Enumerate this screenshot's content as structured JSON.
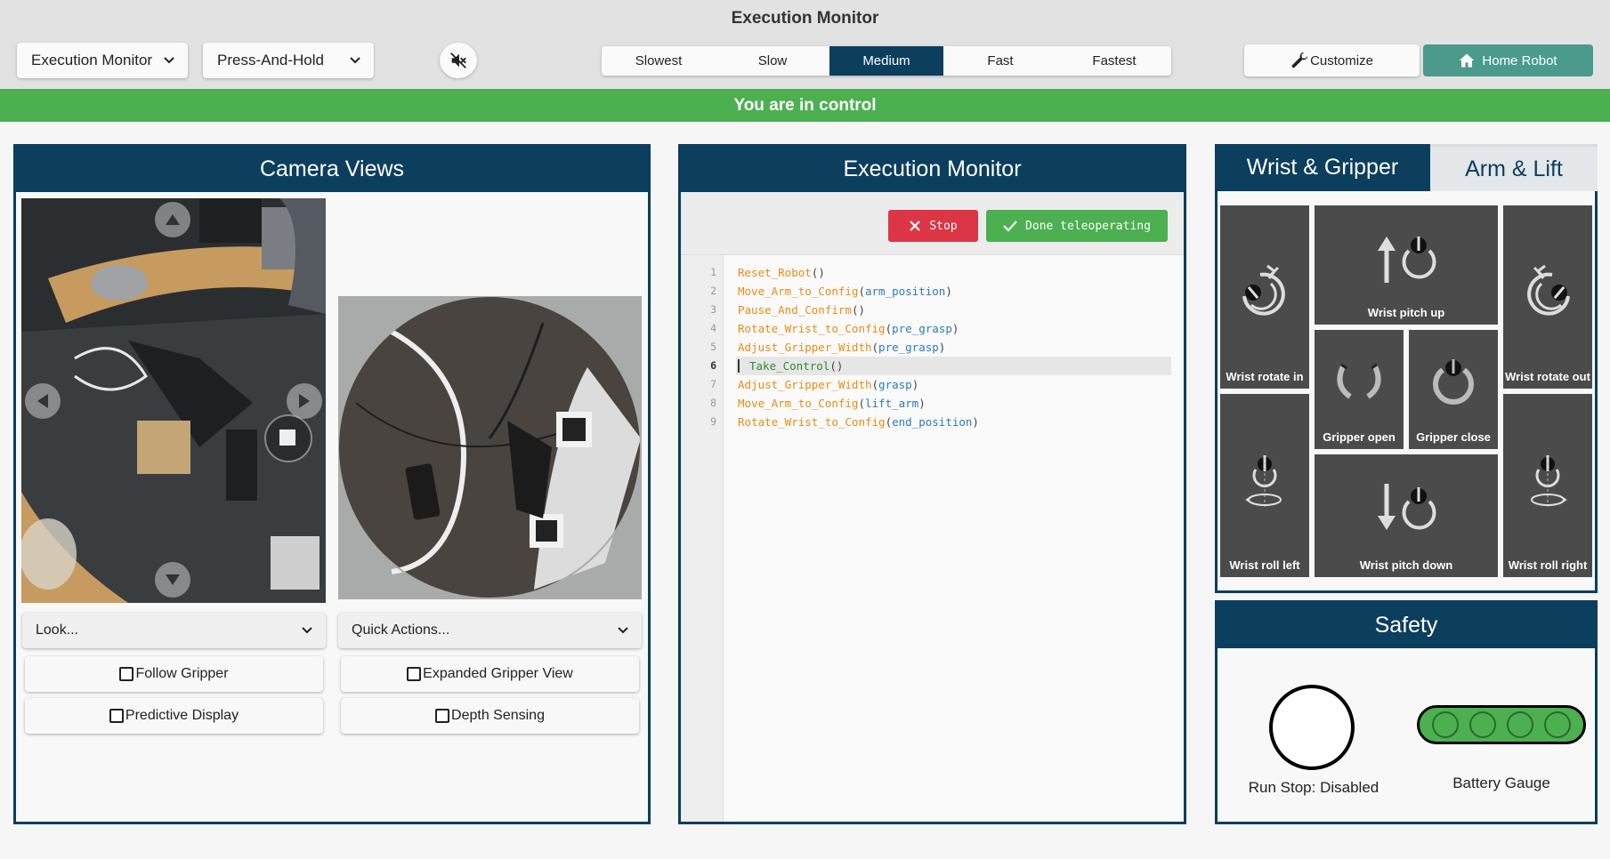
{
  "header": {
    "title": "Execution Monitor",
    "mode_select": "Execution Monitor",
    "action_select": "Press-And-Hold",
    "mute_icon": "speaker-muted-icon",
    "speeds": [
      "Slowest",
      "Slow",
      "Medium",
      "Fast",
      "Fastest"
    ],
    "active_speed": "Medium",
    "customize_label": "Customize",
    "home_label": "Home Robot"
  },
  "banner": {
    "text": "You are in control",
    "color": "#4caf50"
  },
  "camera": {
    "title": "Camera Views",
    "look_select": "Look...",
    "quick_actions_select": "Quick Actions...",
    "checkboxes": {
      "follow_gripper": "Follow Gripper",
      "expanded_gripper_view": "Expanded Gripper View",
      "predictive_display": "Predictive Display",
      "depth_sensing": "Depth Sensing"
    }
  },
  "execution": {
    "title": "Execution Monitor",
    "stop_label": "Stop",
    "done_label": "Done teleoperating",
    "current_line": 6,
    "lines": [
      {
        "n": "1",
        "fn": "Reset_Robot",
        "open": "(",
        "arg": "",
        "close": ")"
      },
      {
        "n": "2",
        "fn": "Move_Arm_to_Config",
        "open": "(",
        "arg": "arm_position",
        "close": ")"
      },
      {
        "n": "3",
        "fn": "Pause_And_Confirm",
        "open": "(",
        "arg": "",
        "close": ")"
      },
      {
        "n": "4",
        "fn": "Rotate_Wrist_to_Config",
        "open": "(",
        "arg": "pre_grasp",
        "close": ")"
      },
      {
        "n": "5",
        "fn": "Adjust_Gripper_Width",
        "open": "(",
        "arg": "pre_grasp",
        "close": ")"
      },
      {
        "n": "6",
        "fn": "Take_Control",
        "open": "(",
        "arg": "",
        "close": ")"
      },
      {
        "n": "7",
        "fn": "Adjust_Gripper_Width",
        "open": "(",
        "arg": "grasp",
        "close": ")"
      },
      {
        "n": "8",
        "fn": "Move_Arm_to_Config",
        "open": "(",
        "arg": "lift_arm",
        "close": ")"
      },
      {
        "n": "9",
        "fn": "Rotate_Wrist_to_Config",
        "open": "(",
        "arg": "end_position",
        "close": ")"
      }
    ]
  },
  "wrist": {
    "tabs": [
      "Wrist & Gripper",
      "Arm & Lift"
    ],
    "active_tab": "Wrist & Gripper",
    "buttons": {
      "rotate_in": "Wrist rotate in",
      "pitch_up": "Wrist pitch up",
      "rotate_out": "Wrist rotate out",
      "gripper_open": "Gripper open",
      "gripper_close": "Gripper close",
      "roll_left": "Wrist roll left",
      "pitch_down": "Wrist pitch down",
      "roll_right": "Wrist roll right"
    }
  },
  "safety": {
    "title": "Safety",
    "runstop_label": "Run Stop: Disabled",
    "battery_label": "Battery Gauge",
    "battery_color": "#4caf50"
  },
  "colors": {
    "navy": "#0c3e5e",
    "teal": "#4a9b8c",
    "stop_red": "#dc3545",
    "green": "#4caf50"
  }
}
